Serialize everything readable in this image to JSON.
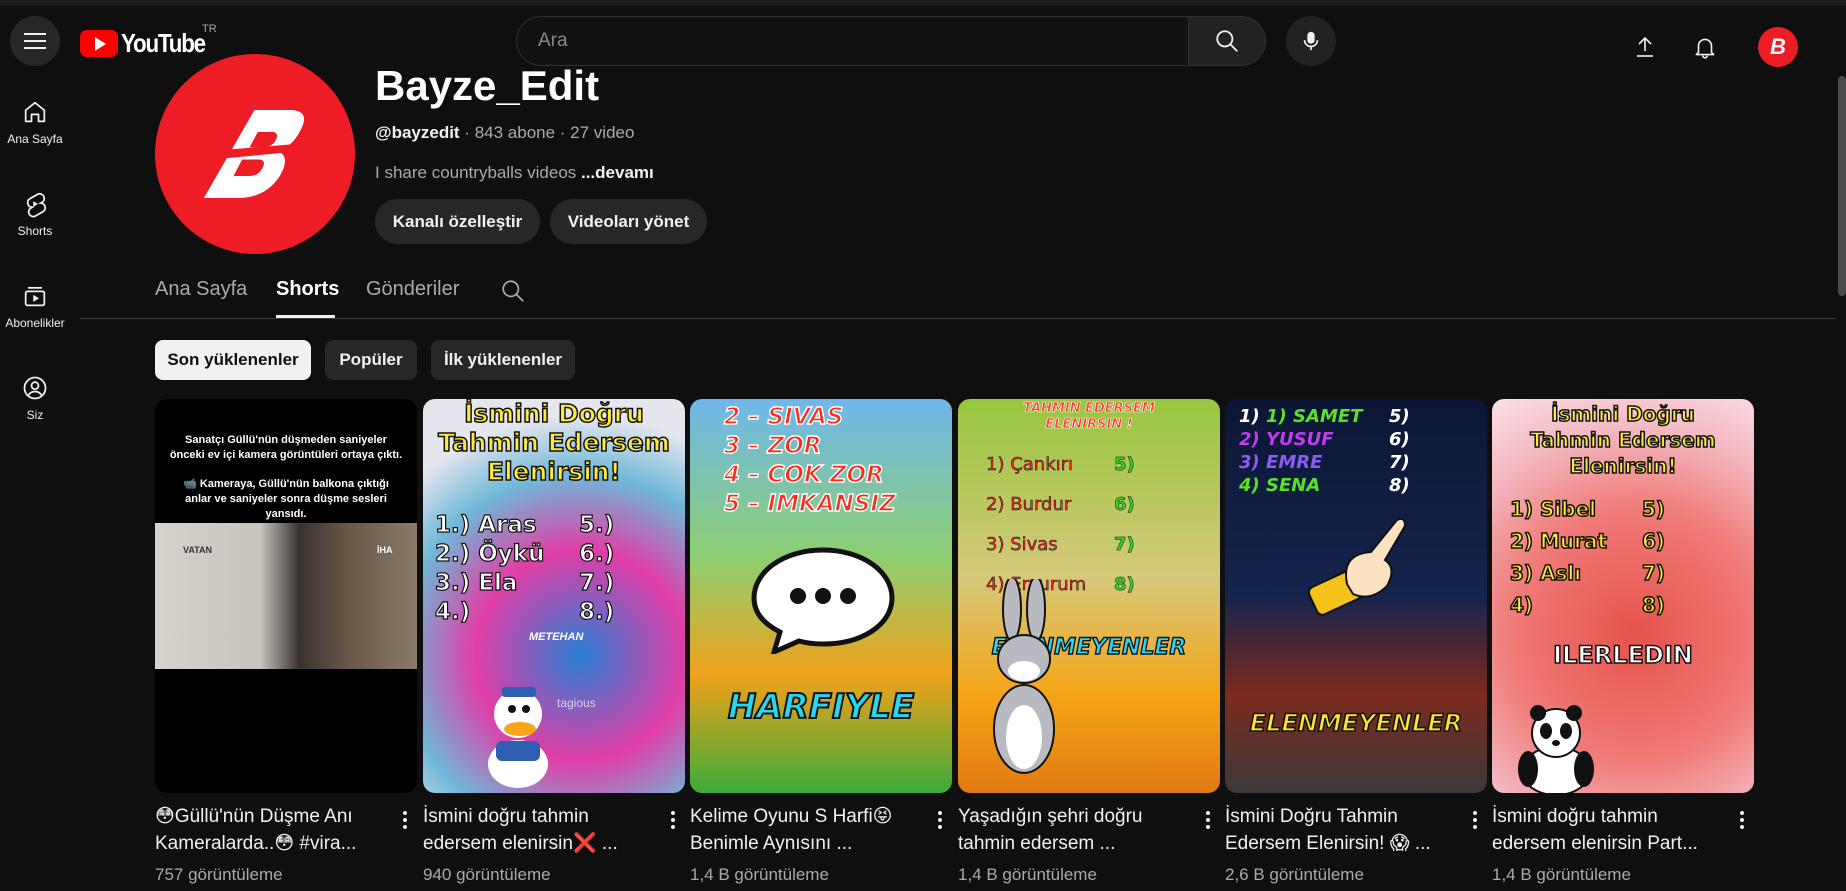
{
  "header": {
    "logo_text": "YouTube",
    "country": "TR",
    "search_placeholder": "Ara",
    "avatar_letter": "B"
  },
  "sidebar": {
    "items": [
      {
        "label": "Ana Sayfa",
        "icon": "home-icon"
      },
      {
        "label": "Shorts",
        "icon": "shorts-icon"
      },
      {
        "label": "Abonelikler",
        "icon": "subscriptions-icon"
      },
      {
        "label": "Siz",
        "icon": "you-icon"
      }
    ]
  },
  "channel": {
    "name": "Bayze_Edit",
    "handle": "@bayzedit",
    "subscribers": " · 843 abone · 27 video",
    "description": "I share countryballs videos ",
    "more": "...devamı",
    "customize_label": "Kanalı özelleştir",
    "manage_label": "Videoları yönet",
    "avatar_letter": "B"
  },
  "tabs": [
    {
      "label": "Ana Sayfa",
      "active": false
    },
    {
      "label": "Shorts",
      "active": true
    },
    {
      "label": "Gönderiler",
      "active": false
    }
  ],
  "chips": [
    {
      "label": "Son yüklenenler",
      "active": true
    },
    {
      "label": "Popüler",
      "active": false
    },
    {
      "label": "İlk yüklenenler",
      "active": false
    }
  ],
  "shorts": [
    {
      "title": "😳Güllü'nün Düşme Anı Kameralarda..😳 #vira...",
      "views": "757 görüntüleme",
      "thumb_text_1": "Sanatçı Güllü'nün düşmeden saniyeler önceki ev içi kamera görüntüleri ortaya çıktı.",
      "thumb_text_2": "📹 Kameraya, Güllü'nün balkona çıktığı anlar ve saniyeler sonra düşme sesleri yansıdı.",
      "thumb_text_3": "VATAN",
      "thumb_text_4": "İHA"
    },
    {
      "title": "İsmini doğru tahmin edersem elenirsin❌ ...",
      "views": "940 görüntüleme",
      "heading": "İsmini Doğru Tahmin Edersem Elenirsin!",
      "left": [
        "1.) Aras",
        "2.) Öykü",
        "3.) Ela",
        "4.)"
      ],
      "right": [
        "5.)",
        "6.)",
        "7.)",
        "8.)"
      ],
      "tag": "METEHAN",
      "watermark": "tagious"
    },
    {
      "title": "Kelime Oyunu S Harfi😝 Benimle Aynısını ...",
      "views": "1,4 B görüntüleme",
      "levels": [
        "2 – SIVAS",
        "3 – ZOR",
        "4 – COK ZOR",
        "5 – IMKANSIZ"
      ],
      "caption": "HARFIYLE"
    },
    {
      "title": "Yaşadığın şehri doğru tahmin edersem ...",
      "views": "1,4 B görüntüleme",
      "heading": "TAHMIN EDERSEM ELENIRSIN !",
      "left": [
        "1) Çankırı",
        "2) Burdur",
        "3) Sivas",
        "4) Erzurum"
      ],
      "right": [
        "5)",
        "6)",
        "7)",
        "8)"
      ],
      "caption": "ELENMEYENLER"
    },
    {
      "title": "İsmini Doğru Tahmin Edersem Elenirsin! 😱 ...",
      "views": "2,6 B görüntüleme",
      "left": [
        "1) SAMET",
        "2) YUSUF",
        "3) EMRE",
        "4) SENA"
      ],
      "right": [
        "5)",
        "6)",
        "7)",
        "8)"
      ],
      "caption": "ELENMEYENLER"
    },
    {
      "title": "İsmini doğru tahmin edersem elenirsin Part...",
      "views": "1,4 B görüntüleme",
      "heading": "İsmini Doğru Tahmin Edersem Elenirsin!",
      "left": [
        "1) Sibel",
        "2) Murat",
        "3) Aslı",
        "4)"
      ],
      "right": [
        "5)",
        "6)",
        "7)",
        "8)"
      ],
      "caption": "ILERLEDIN"
    }
  ],
  "colors": {
    "background": "#0f0f0f",
    "brand_red": "#ff0000",
    "channel_red": "#ee1c25"
  }
}
